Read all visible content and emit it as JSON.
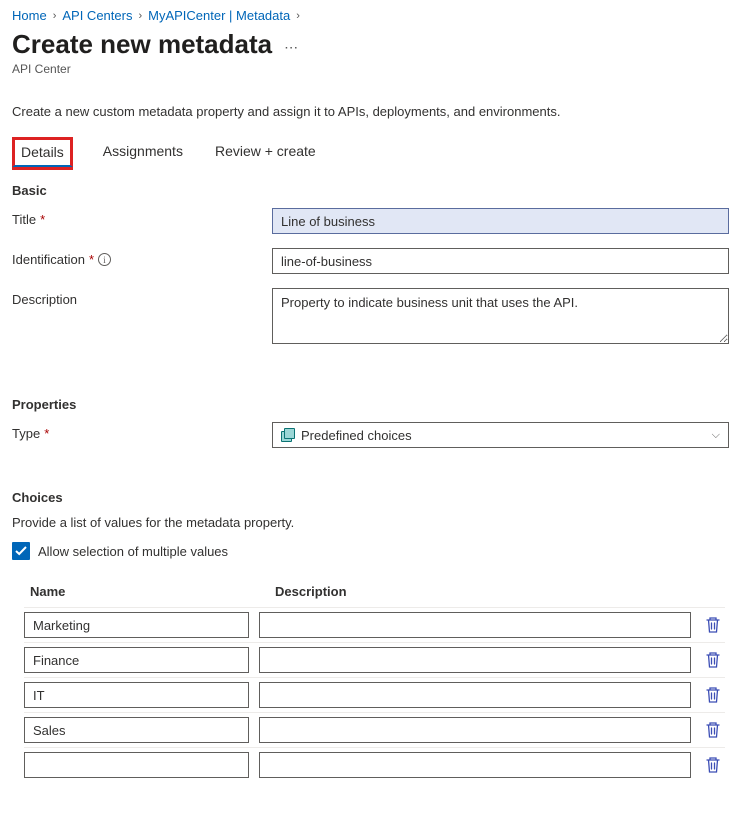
{
  "breadcrumb": {
    "items": [
      "Home",
      "API Centers",
      "MyAPICenter | Metadata"
    ]
  },
  "page": {
    "title": "Create new metadata",
    "subtitle": "API Center",
    "intro": "Create a new custom metadata property and assign it to APIs, deployments, and environments."
  },
  "tabs": {
    "details": "Details",
    "assignments": "Assignments",
    "review": "Review + create"
  },
  "sections": {
    "basic": "Basic",
    "properties": "Properties",
    "choices": "Choices"
  },
  "fields": {
    "title_label": "Title",
    "title_value": "Line of business",
    "id_label": "Identification",
    "id_value": "line-of-business",
    "desc_label": "Description",
    "desc_value": "Property to indicate business unit that uses the API.",
    "type_label": "Type",
    "type_value": "Predefined choices"
  },
  "choices": {
    "intro": "Provide a list of values for the metadata property.",
    "allow_multi_label": "Allow selection of multiple values",
    "header_name": "Name",
    "header_desc": "Description",
    "rows": [
      {
        "name": "Marketing",
        "desc": ""
      },
      {
        "name": "Finance",
        "desc": ""
      },
      {
        "name": "IT",
        "desc": ""
      },
      {
        "name": "Sales",
        "desc": ""
      },
      {
        "name": "",
        "desc": ""
      }
    ]
  }
}
